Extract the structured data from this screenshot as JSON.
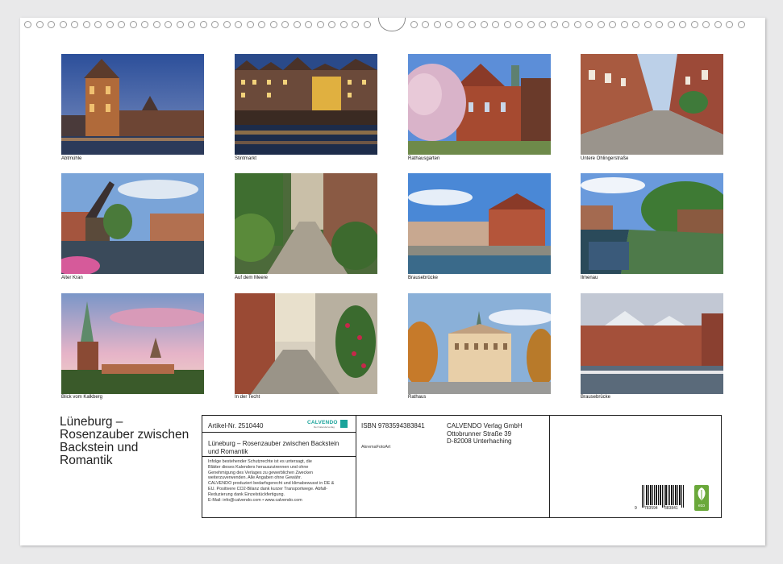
{
  "calendar": {
    "title_lines": [
      "Lüneburg –",
      "Rosenzauber zwischen",
      "Backstein und",
      "Romantik"
    ],
    "photos": [
      {
        "caption": "Abtmühle"
      },
      {
        "caption": "Stintmarkt"
      },
      {
        "caption": "Rathausgarten"
      },
      {
        "caption": "Untere Ohlingerstraße"
      },
      {
        "caption": "Alter Kran"
      },
      {
        "caption": "Auf dem Meere"
      },
      {
        "caption": "Brausebrücke"
      },
      {
        "caption": "Ilmenau"
      },
      {
        "caption": "Blick vom Kalkberg"
      },
      {
        "caption": "In der Techt"
      },
      {
        "caption": "Rathaus"
      },
      {
        "caption": "Brausebrücke"
      }
    ]
  },
  "imprint": {
    "article_number": "Artikel-Nr. 2510440",
    "calvendo_logo": "CALVENDO",
    "calvendo_tagline": "Der Kalenderverlag",
    "product_title_lines": [
      "Lüneburg – Rosenzauber zwischen Backstein",
      "und Romantik"
    ],
    "legal_lines": [
      "Infolge bestehender Schutzrechte ist es untersagt, die",
      "Blätter dieses Kalenders herauszutrennen und ohne",
      "Genehmigung des Verlages zu gewerblichen Zwecken",
      "weiterzuverwenden. Alle Angaben ohne Gewähr.",
      "CALVENDO produziert bedarfsgerecht und klimabewusst in DE &",
      "EU. Positivere CO2-Bilanz dank kurzer Transportwege. Abfall-",
      "Reduzierung dank Einzelstückfertigung.",
      "E-Mail: info@calvendo.com • www.calvendo.com"
    ],
    "isbn": "ISBN 9783594383841",
    "author": "AkremaFotoArt",
    "publisher_lines": [
      "CALVENDO Verlag GmbH",
      "Ottobrunner Straße 39",
      "D-82008 Unterhaching"
    ],
    "barcode_digits": [
      "9",
      "783594",
      "383841"
    ],
    "eco_logo": "eco"
  },
  "colors": {
    "calvendo_teal": "#1aa39a",
    "eco_green": "#6aa83a"
  }
}
